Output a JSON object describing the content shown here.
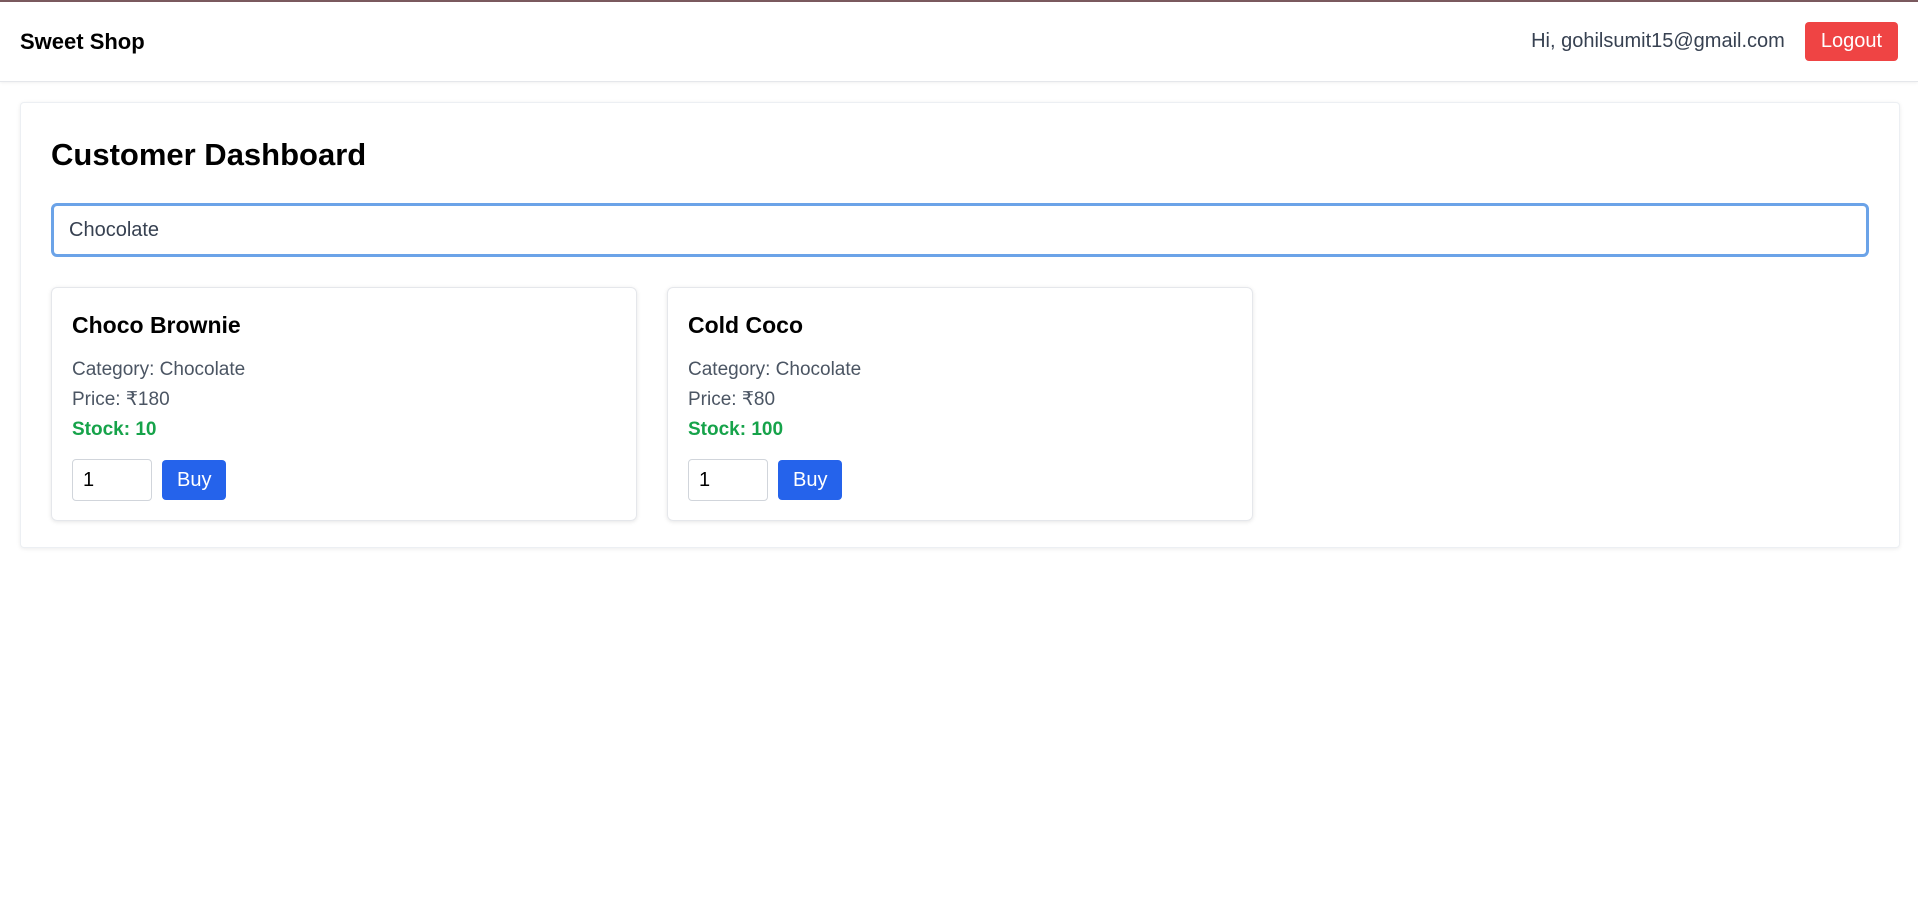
{
  "header": {
    "brand": "Sweet Shop",
    "greeting": "Hi, gohilsumit15@gmail.com",
    "logout_label": "Logout"
  },
  "dashboard": {
    "title": "Customer Dashboard",
    "search_value": "Chocolate"
  },
  "products": [
    {
      "name": "Choco Brownie",
      "category": "Category: Chocolate",
      "price": "Price: ₹180",
      "stock": "Stock: 10",
      "quantity": "1",
      "buy_label": "Buy"
    },
    {
      "name": "Cold Coco",
      "category": "Category: Chocolate",
      "price": "Price: ₹80",
      "stock": "Stock: 100",
      "quantity": "1",
      "buy_label": "Buy"
    }
  ],
  "colors": {
    "logout": "#ef4444",
    "buy": "#2563eb",
    "stock": "#16a34a",
    "search_focus_border": "#6ba3e8"
  }
}
